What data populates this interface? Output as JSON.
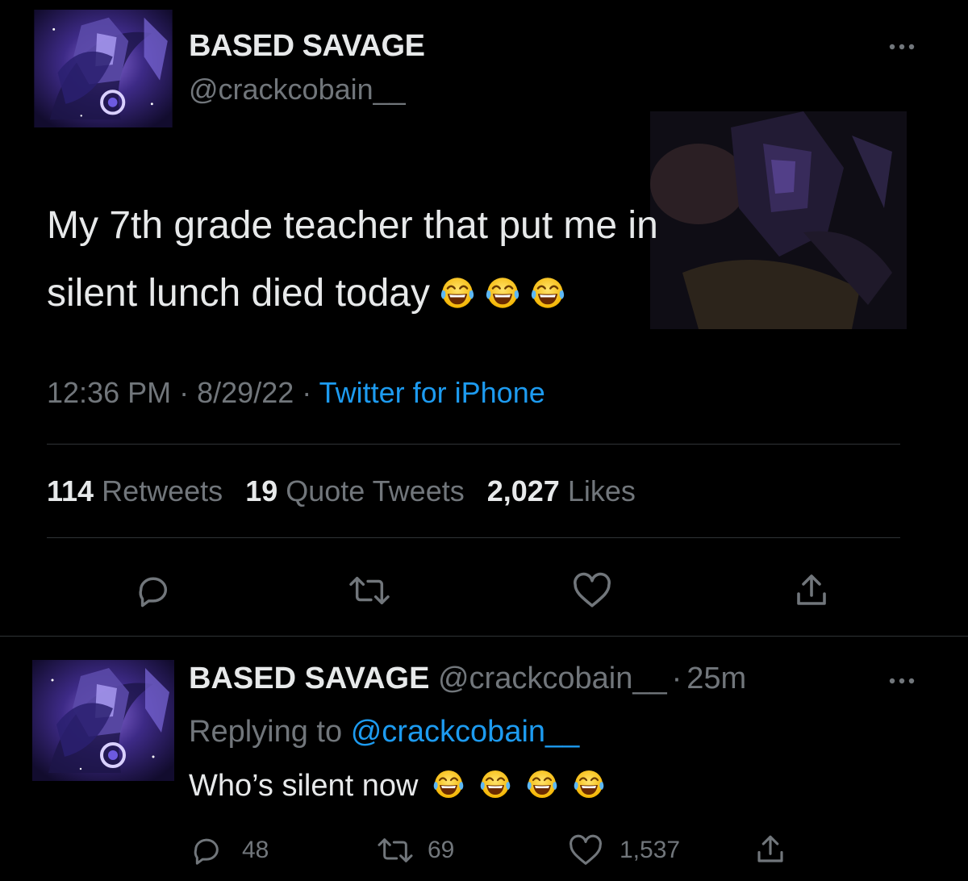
{
  "main_tweet": {
    "display_name": "BASED SAVAGE",
    "handle": "@crackcobain__",
    "text_line1": "My 7th grade teacher that put me in",
    "text_line2": "silent lunch died today",
    "emoji": "face-with-tears-of-joy",
    "time": "12:36 PM",
    "date": "8/29/22",
    "source": "Twitter for iPhone",
    "stats": {
      "retweets_count": "114",
      "retweets_label": "Retweets",
      "quotes_count": "19",
      "quotes_label": "Quote Tweets",
      "likes_count": "2,027",
      "likes_label": "Likes"
    },
    "actions": [
      "reply-icon",
      "retweet-icon",
      "like-icon",
      "share-icon"
    ]
  },
  "reply_tweet": {
    "display_name": "BASED SAVAGE",
    "handle": "@crackcobain__",
    "time_ago": "25m",
    "replying_label": "Replying to",
    "replying_handle": "@crackcobain__",
    "text": "Who’s silent now",
    "reply_count": "48",
    "retweet_count": "69",
    "like_count": "1,537"
  },
  "separators": {
    "dot": "·"
  },
  "colors": {
    "background": "#000000",
    "text": "#e7e9ea",
    "muted": "#71767b",
    "accent": "#1d9bf0",
    "divider": "#2f3336"
  }
}
